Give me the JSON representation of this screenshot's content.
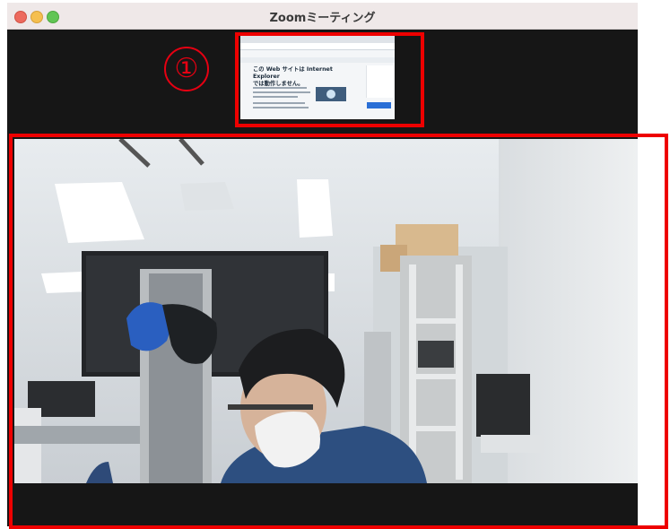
{
  "window": {
    "title": "Zoomミーティング"
  },
  "annotation": {
    "marker": "①",
    "marker_color": "#e60012",
    "frame_color": "#ee0000"
  },
  "shared_screen": {
    "heading_line1": "この Web サイトは Internet Explorer",
    "heading_line2": "では動作しません。"
  },
  "colors": {
    "window_bg": "#161616",
    "titlebar_bg": "#efe8e8"
  }
}
